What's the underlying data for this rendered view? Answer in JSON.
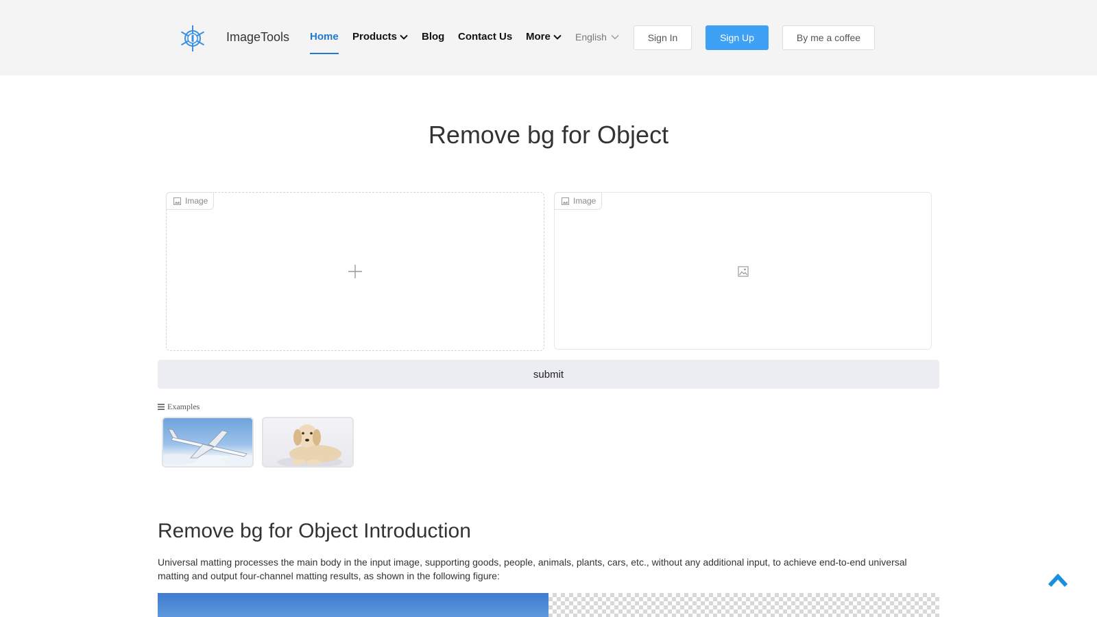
{
  "header": {
    "brand": "ImageTools",
    "logo_icon": "snowflake-logo-icon",
    "nav": {
      "home": "Home",
      "products": "Products",
      "blog": "Blog",
      "contact": "Contact Us",
      "more": "More"
    },
    "language": "English",
    "sign_in": "Sign In",
    "sign_up": "Sign Up",
    "coffee": "By me a coffee"
  },
  "main": {
    "title": "Remove bg for Object",
    "input_panel": {
      "tag": "Image"
    },
    "output_panel": {
      "tag": "Image"
    },
    "submit_label": "submit",
    "examples_label": "Examples",
    "examples": [
      "airplane",
      "dog"
    ]
  },
  "intro": {
    "heading": "Remove bg for Object Introduction",
    "text": "Universal matting processes the main body in the input image, supporting goods, people, animals, plants, cars, etc., without any additional input, to achieve end-to-end universal matting and output four-channel matting results, as shown in the following figure:"
  },
  "colors": {
    "accent": "#1f78d1",
    "primary_button": "#3ea1f5",
    "header_bg": "#f4f4f4",
    "submit_bg": "#ececf3"
  }
}
